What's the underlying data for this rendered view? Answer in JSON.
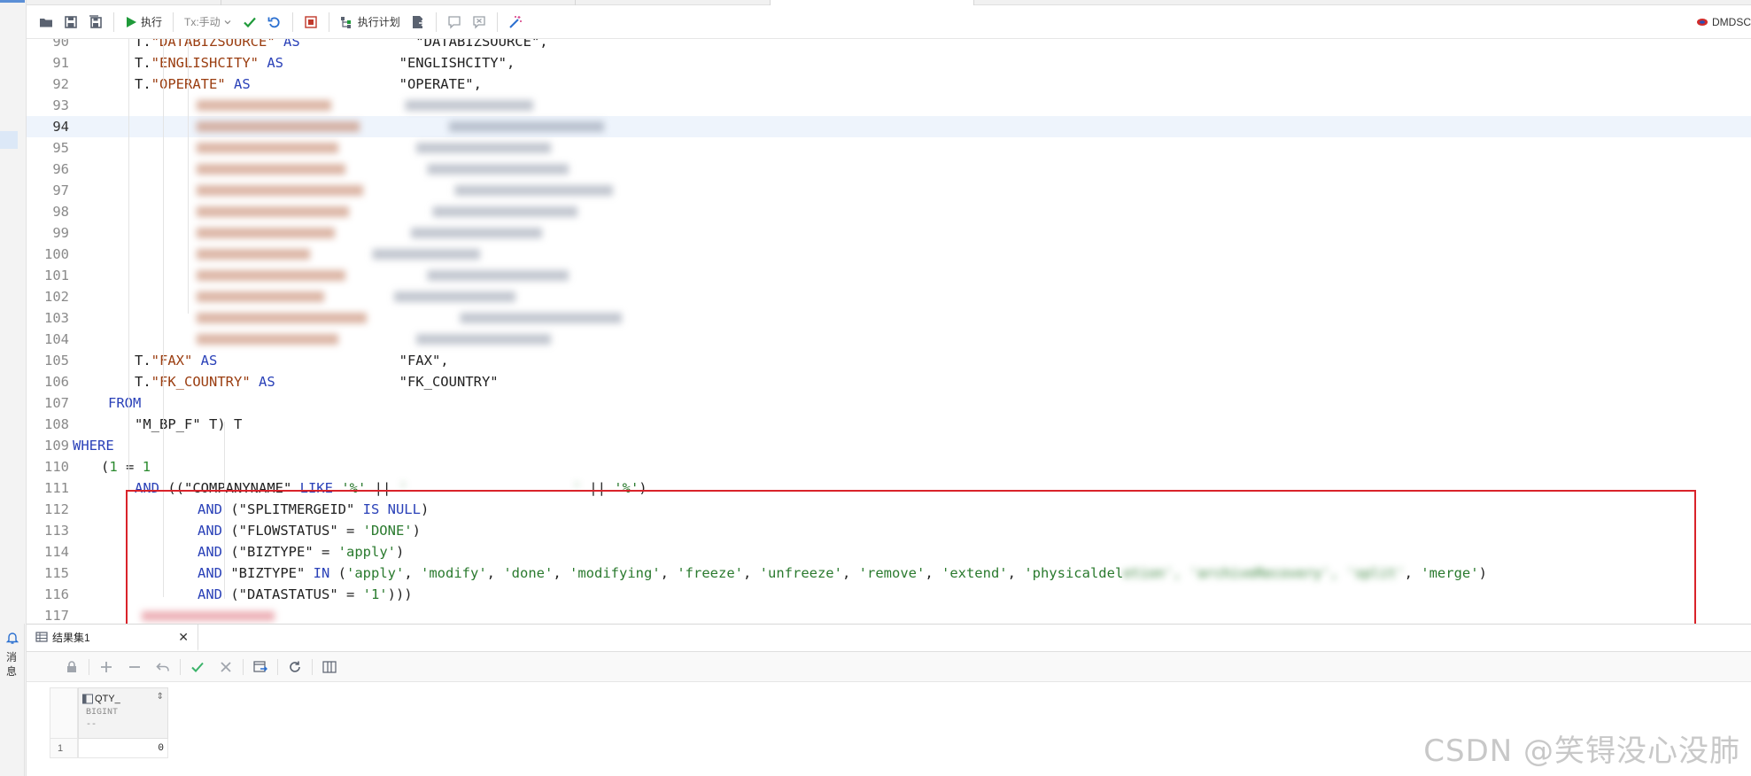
{
  "toolbar": {
    "execute_label": "执行",
    "tx_label": "Tx:手动",
    "plan_label": "执行计划",
    "connection_label": "DMDSC"
  },
  "editor": {
    "current_line": 94,
    "lines": [
      {
        "n": "90",
        "tokens": [
          {
            "t": "T.",
            "c": "plain"
          },
          {
            "t": "\"DATABIZSOURCE\"",
            "c": "id"
          },
          {
            "t": " AS",
            "c": "kw"
          },
          {
            "t": "              \"DATABIZSOURCE\",",
            "c": "plain"
          }
        ]
      },
      {
        "n": "91",
        "tokens": [
          {
            "t": "T.",
            "c": "plain"
          },
          {
            "t": "\"ENGLISHCITY\"",
            "c": "id"
          },
          {
            "t": " AS",
            "c": "kw"
          },
          {
            "t": "              \"ENGLISHCITY\",",
            "c": "plain"
          }
        ]
      },
      {
        "n": "92",
        "tokens": [
          {
            "t": "T.",
            "c": "plain"
          },
          {
            "t": "\"OPERATE\"",
            "c": "id"
          },
          {
            "t": " AS",
            "c": "kw"
          },
          {
            "t": "                  \"OPERATE\",",
            "c": "plain"
          }
        ]
      },
      {
        "n": "93",
        "tokens": []
      },
      {
        "n": "94",
        "tokens": []
      },
      {
        "n": "95",
        "tokens": []
      },
      {
        "n": "96",
        "tokens": []
      },
      {
        "n": "97",
        "tokens": []
      },
      {
        "n": "98",
        "tokens": []
      },
      {
        "n": "99",
        "tokens": []
      },
      {
        "n": "100",
        "tokens": []
      },
      {
        "n": "101",
        "tokens": []
      },
      {
        "n": "102",
        "tokens": []
      },
      {
        "n": "103",
        "tokens": []
      },
      {
        "n": "104",
        "tokens": []
      },
      {
        "n": "105",
        "tokens": [
          {
            "t": "T.",
            "c": "plain"
          },
          {
            "t": "\"FAX\"",
            "c": "id"
          },
          {
            "t": " AS",
            "c": "kw"
          },
          {
            "t": "                      \"FAX\",",
            "c": "plain"
          }
        ]
      },
      {
        "n": "106",
        "tokens": [
          {
            "t": "T.",
            "c": "plain"
          },
          {
            "t": "\"FK_COUNTRY\"",
            "c": "id"
          },
          {
            "t": " AS",
            "c": "kw"
          },
          {
            "t": "               \"FK_COUNTRY\"",
            "c": "plain"
          }
        ]
      },
      {
        "n": "107",
        "tokens": [
          {
            "t": "FROM",
            "c": "kw"
          }
        ]
      },
      {
        "n": "108",
        "tokens": [
          {
            "t": "\"M_BP_F\" T",
            "c": "plain"
          },
          {
            "t": ")",
            "c": "plain"
          },
          {
            "t": " T",
            "c": "plain"
          }
        ]
      },
      {
        "n": "109",
        "tokens": [
          {
            "t": "WHERE",
            "c": "kw"
          }
        ]
      },
      {
        "n": "110",
        "tokens": [
          {
            "t": "(",
            "c": "plain"
          },
          {
            "t": "1",
            "c": "num"
          },
          {
            "t": " = ",
            "c": "plain"
          },
          {
            "t": "1",
            "c": "num"
          }
        ]
      },
      {
        "n": "111",
        "tokens": [
          {
            "t": "AND",
            "c": "kw"
          },
          {
            "t": " ((\"COMPANYNAME\" ",
            "c": "plain"
          },
          {
            "t": "LIKE",
            "c": "kw"
          },
          {
            "t": " ",
            "c": "plain"
          },
          {
            "t": "'%'",
            "c": "str"
          },
          {
            "t": " || ",
            "c": "plain"
          },
          {
            "t": "'                    '",
            "c": "str blur"
          },
          {
            "t": " || ",
            "c": "plain"
          },
          {
            "t": "'%'",
            "c": "str"
          },
          {
            "t": ")",
            "c": "plain"
          }
        ]
      },
      {
        "n": "112",
        "tokens": [
          {
            "t": "AND",
            "c": "kw"
          },
          {
            "t": " (\"SPLITMERGEID\" ",
            "c": "plain"
          },
          {
            "t": "IS NULL",
            "c": "kw"
          },
          {
            "t": ")",
            "c": "plain"
          }
        ]
      },
      {
        "n": "113",
        "tokens": [
          {
            "t": "AND",
            "c": "kw"
          },
          {
            "t": " (\"FLOWSTATUS\" = ",
            "c": "plain"
          },
          {
            "t": "'DONE'",
            "c": "str"
          },
          {
            "t": ")",
            "c": "plain"
          }
        ]
      },
      {
        "n": "114",
        "tokens": [
          {
            "t": "AND",
            "c": "kw"
          },
          {
            "t": " (\"BIZTYPE\" = ",
            "c": "plain"
          },
          {
            "t": "'apply'",
            "c": "str"
          },
          {
            "t": ")",
            "c": "plain"
          }
        ]
      },
      {
        "n": "115",
        "tokens": [
          {
            "t": "AND",
            "c": "kw"
          },
          {
            "t": " \"BIZTYPE\" ",
            "c": "plain"
          },
          {
            "t": "IN",
            "c": "kw"
          },
          {
            "t": " (",
            "c": "plain"
          },
          {
            "t": "'apply'",
            "c": "str"
          },
          {
            "t": ", ",
            "c": "plain"
          },
          {
            "t": "'modify'",
            "c": "str"
          },
          {
            "t": ", ",
            "c": "plain"
          },
          {
            "t": "'done'",
            "c": "str"
          },
          {
            "t": ", ",
            "c": "plain"
          },
          {
            "t": "'modifying'",
            "c": "str"
          },
          {
            "t": ", ",
            "c": "plain"
          },
          {
            "t": "'freeze'",
            "c": "str"
          },
          {
            "t": ", ",
            "c": "plain"
          },
          {
            "t": "'unfreeze'",
            "c": "str"
          },
          {
            "t": ", ",
            "c": "plain"
          },
          {
            "t": "'remove'",
            "c": "str"
          },
          {
            "t": ", ",
            "c": "plain"
          },
          {
            "t": "'extend'",
            "c": "str"
          },
          {
            "t": ", ",
            "c": "plain"
          },
          {
            "t": "'physicaldel",
            "c": "str"
          },
          {
            "t": "etion', 'archiveRecovery', 'split'",
            "c": "str blur"
          },
          {
            "t": ", ",
            "c": "plain"
          },
          {
            "t": "'merge'",
            "c": "str"
          },
          {
            "t": ")",
            "c": "plain"
          }
        ]
      },
      {
        "n": "116",
        "tokens": [
          {
            "t": "AND",
            "c": "kw"
          },
          {
            "t": " (\"DATASTATUS\" = ",
            "c": "plain"
          },
          {
            "t": "'1'",
            "c": "str"
          },
          {
            "t": ")))",
            "c": "plain"
          }
        ]
      },
      {
        "n": "117",
        "tokens": []
      }
    ]
  },
  "side_panel": {
    "messages_label": "消息"
  },
  "results": {
    "tab_label": "结果集1",
    "columns": [
      {
        "name": "QTY_",
        "type": "BIGINT",
        "nullable": "--"
      }
    ],
    "rows": [
      {
        "num": "1",
        "values": [
          "0"
        ]
      }
    ]
  },
  "watermark": "CSDN @笑锝没心没肺"
}
